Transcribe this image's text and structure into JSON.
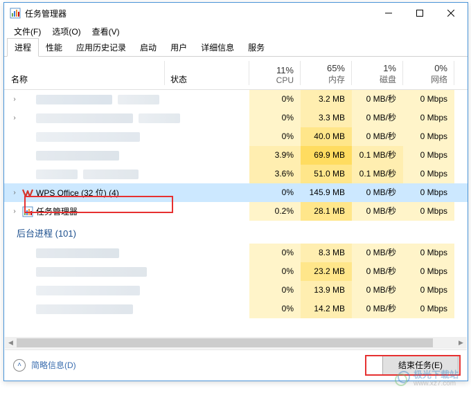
{
  "window": {
    "title": "任务管理器"
  },
  "menus": {
    "file": "文件(F)",
    "options": "选项(O)",
    "view": "查看(V)"
  },
  "tabs": {
    "processes": "进程",
    "performance": "性能",
    "app_history": "应用历史记录",
    "startup": "启动",
    "users": "用户",
    "details": "详细信息",
    "services": "服务"
  },
  "columns": {
    "name": "名称",
    "status": "状态",
    "cpu": {
      "pct": "11%",
      "label": "CPU"
    },
    "memory": {
      "pct": "65%",
      "label": "内存"
    },
    "disk": {
      "pct": "1%",
      "label": "磁盘"
    },
    "network": {
      "pct": "0%",
      "label": "网络"
    }
  },
  "rows": [
    {
      "cpu": "0%",
      "mem": "3.2 MB",
      "disk": "0 MB/秒",
      "net": "0 Mbps"
    },
    {
      "cpu": "0%",
      "mem": "3.3 MB",
      "disk": "0 MB/秒",
      "net": "0 Mbps"
    },
    {
      "cpu": "0%",
      "mem": "40.0 MB",
      "disk": "0 MB/秒",
      "net": "0 Mbps"
    },
    {
      "cpu": "3.9%",
      "mem": "69.9 MB",
      "disk": "0.1 MB/秒",
      "net": "0 Mbps"
    },
    {
      "cpu": "3.6%",
      "mem": "51.0 MB",
      "disk": "0.1 MB/秒",
      "net": "0 Mbps"
    },
    {
      "name": "WPS Office (32 位) (4)",
      "cpu": "0%",
      "mem": "145.9 MB",
      "disk": "0 MB/秒",
      "net": "0 Mbps"
    },
    {
      "name": "任务管理器",
      "cpu": "0.2%",
      "mem": "28.1 MB",
      "disk": "0 MB/秒",
      "net": "0 Mbps"
    }
  ],
  "section": {
    "background": "后台进程 (101)"
  },
  "bg_rows": [
    {
      "cpu": "0%",
      "mem": "8.3 MB",
      "disk": "0 MB/秒",
      "net": "0 Mbps"
    },
    {
      "cpu": "0%",
      "mem": "23.2 MB",
      "disk": "0 MB/秒",
      "net": "0 Mbps"
    },
    {
      "cpu": "0%",
      "mem": "13.9 MB",
      "disk": "0 MB/秒",
      "net": "0 Mbps"
    },
    {
      "cpu": "0%",
      "mem": "14.2 MB",
      "disk": "0 MB/秒",
      "net": "0 Mbps"
    }
  ],
  "footer": {
    "brief": "简略信息(D)",
    "end_task": "结束任务(E)"
  },
  "watermark": {
    "main": "极光下载站",
    "sub": "www.xz7.com"
  }
}
